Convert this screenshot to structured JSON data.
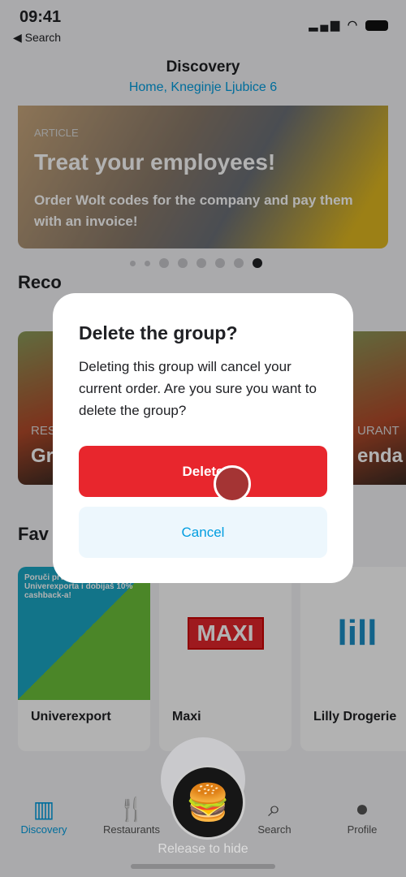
{
  "status": {
    "time": "09:41",
    "back": "◀ Search"
  },
  "header": {
    "title": "Discovery",
    "address": "Home, Kneginje Ljubice 6"
  },
  "banner": {
    "tag": "ARTICLE",
    "title": "Treat your employees!",
    "subtitle": "Order Wolt codes for the company and pay them with an invoice!",
    "dots": 8,
    "active": 7
  },
  "sections": {
    "recommendations": "Reco",
    "favourites": "Fav"
  },
  "rec_cards": [
    {
      "tag": "RES",
      "name": "Gr"
    },
    {
      "tag": "URANT",
      "name": "enda"
    }
  ],
  "fav_cards": [
    {
      "name": "Univerexport",
      "promo": "Poruči prvi put iz Univerexporta i dobijaš 10% cashback-a!"
    },
    {
      "name": "Maxi",
      "logo": "MAXI"
    },
    {
      "name": "Lilly Drogerie",
      "logo": "lill"
    }
  ],
  "tabs": [
    {
      "label": "Discovery",
      "icon": "discovery-icon"
    },
    {
      "label": "Restaurants",
      "icon": "fork-knife-icon"
    },
    {
      "label": "Search",
      "icon": "search-icon"
    },
    {
      "label": "Profile",
      "icon": "profile-icon"
    }
  ],
  "dialog": {
    "title": "Delete the group?",
    "body": "Deleting this group will cancel your current order. Are you sure you want to delete the group?",
    "delete": "Delete",
    "cancel": "Cancel"
  },
  "floating": {
    "hint": "Release to hide",
    "icon": "burger-icon"
  },
  "colors": {
    "accent": "#009de0",
    "danger": "#e8262d"
  }
}
